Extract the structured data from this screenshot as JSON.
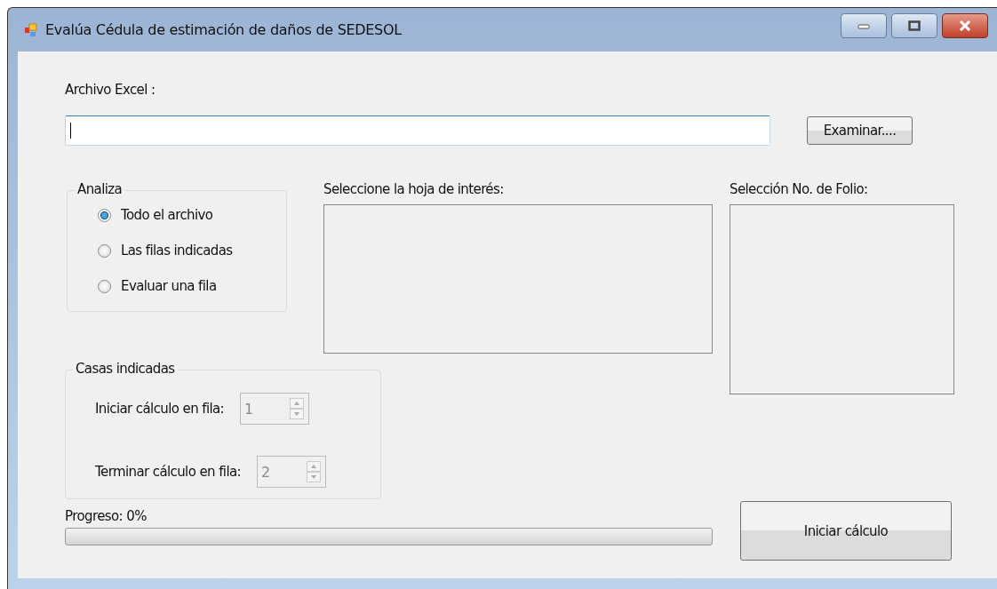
{
  "window": {
    "title": "Evalúa Cédula de estimación de daños de SEDESOL"
  },
  "file": {
    "label": "Archivo Excel :",
    "focused": true,
    "button": "Examinar...."
  },
  "analiza": {
    "title": "Analiza",
    "options": [
      {
        "label": "Todo el archivo",
        "selected": true
      },
      {
        "label": "Las filas indicadas",
        "selected": false
      },
      {
        "label": "Evaluar una fila",
        "selected": false
      }
    ]
  },
  "sheets": {
    "label": "Seleccione la hoja de interés:"
  },
  "folio": {
    "label": "Selección No. de Folio:"
  },
  "casas": {
    "title": "Casas indicadas",
    "rows": [
      {
        "label": "Iniciar cálculo en fila:",
        "value": "1",
        "disabled": true
      },
      {
        "label": "Terminar  cálculo en fila:",
        "value": "2",
        "disabled": true
      }
    ]
  },
  "progress": {
    "label": "Progreso: 0%",
    "level": 0
  },
  "start_button": "Iniciar cálculo"
}
